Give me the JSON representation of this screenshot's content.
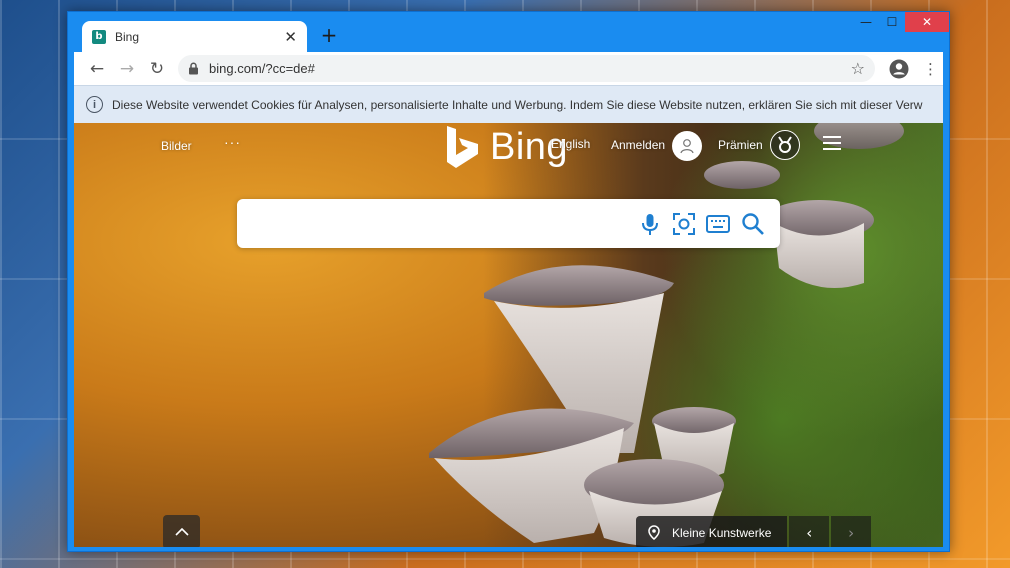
{
  "browser": {
    "tab": {
      "title": "Bing",
      "favicon": "b",
      "close_glyph": "✕"
    },
    "new_tab_glyph": "+",
    "window_controls": {
      "minimize": "—",
      "maximize": "☐",
      "close": "✕"
    },
    "nav": {
      "back": "←",
      "forward": "→",
      "reload": "↻"
    },
    "url": "bing.com/?cc=de#",
    "bookmark_glyph": "☆",
    "menu_glyph": "⋮"
  },
  "infobar": {
    "icon": "i",
    "text": "Diese Website verwendet Cookies für Analysen, personalisierte Inhalte und Werbung. Indem Sie diese Website nutzen, erklären Sie sich mit dieser Verw"
  },
  "bing": {
    "logo_text": "Bing",
    "nav_images": "Bilder",
    "nav_more": "···",
    "english_link": "English",
    "signin": "Anmelden",
    "rewards": "Prämien",
    "search_placeholder": ""
  },
  "image_caption": {
    "title": "Kleine Kunstwerke",
    "prev": "‹",
    "next": "›"
  },
  "colors": {
    "window_frame": "#1a8cf0",
    "close_button": "#e0404b",
    "bing_blue": "#1f7fd0",
    "infobar": "#dfe9f5"
  }
}
